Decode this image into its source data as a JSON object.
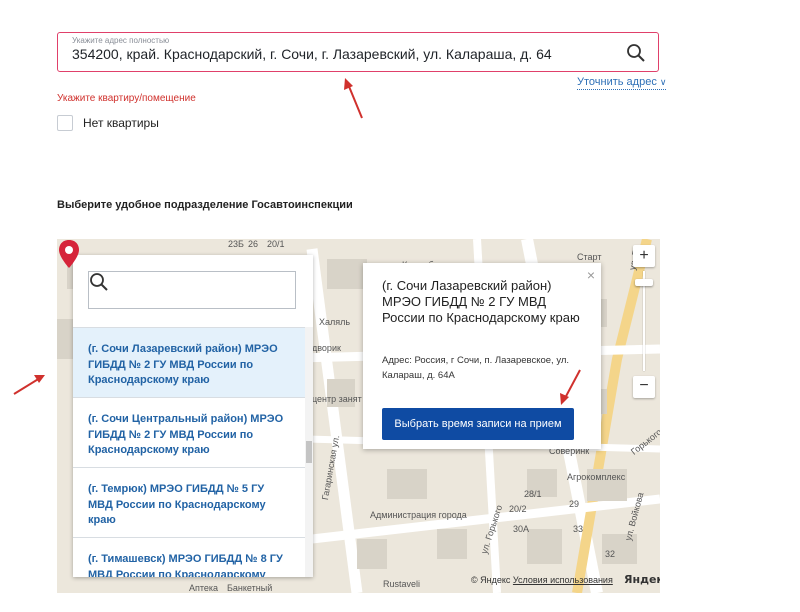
{
  "address": {
    "label": "Укажите адрес полностью",
    "value": "354200, край. Краснодарский, г. Сочи, г. Лазаревский, ул. Калараша, д. 64",
    "refine_link": "Уточнить адрес"
  },
  "apartment": {
    "error": "Укажите квартиру/помещение",
    "no_apartment_label": "Нет квартиры",
    "checked": false
  },
  "section_title": "Выберите удобное подразделение Госавтоинспекции",
  "offices": [
    {
      "label": "(г. Сочи Лазаревский район) МРЭО ГИБДД № 2 ГУ МВД России по Краснодарскому краю",
      "selected": true
    },
    {
      "label": "(г. Сочи Центральный район) МРЭО ГИБДД № 2 ГУ МВД России по Краснодарскому краю",
      "selected": false
    },
    {
      "label": "(г. Темрюк) МРЭО ГИБДД № 5 ГУ МВД России по Краснодарскому краю",
      "selected": false
    },
    {
      "label": "(г. Тимашевск) МРЭО ГИБДД № 8 ГУ МВД России по Краснодарскому",
      "selected": false
    }
  ],
  "popup": {
    "title": "(г. Сочи Лазаревский район) МРЭО ГИБДД № 2 ГУ МВД России по Краснодарскому краю",
    "address": "Адрес: Россия, г Сочи, п. Лазаревское, ул. Калараш, д. 64А",
    "button": "Выбрать время записи на прием",
    "close": "×"
  },
  "map": {
    "labels": {
      "l23b": "23Б",
      "l26": "26",
      "l20_1": "20/1",
      "kolombino": "Коломбино",
      "start": "Старт",
      "halyal": "Халяль",
      "dvorik": "дворик",
      "center_zan": "центр занят",
      "sovereign": "Соверинк",
      "agrokompl": "Агрокомплекс",
      "administration": "Администрация города",
      "n30a": "30А",
      "n33": "33",
      "n28_1": "28/1",
      "n20_2": "20/2",
      "n29": "29",
      "n32": "32",
      "rustaveli": "Rustaveli",
      "bankovy": "Банкетный",
      "farmacy": "Аптека",
      "gorkogo": "ул. Горького",
      "gorkogo2": "Горького",
      "gagarina": "Гагаринская ул.",
      "voykova": "ул. Войкова",
      "ul_g": "ул. Г"
    },
    "zoom_in": "+",
    "zoom_out": "−",
    "attribution": "© Яндекс",
    "terms": "Условия использования",
    "logo": "Яндекс"
  },
  "colors": {
    "error": "#d0312d",
    "field_border": "#e0406a",
    "link": "#2d6fb6",
    "list_text": "#2263a5",
    "button": "#0f4ba3",
    "marker": "#d6243a"
  }
}
